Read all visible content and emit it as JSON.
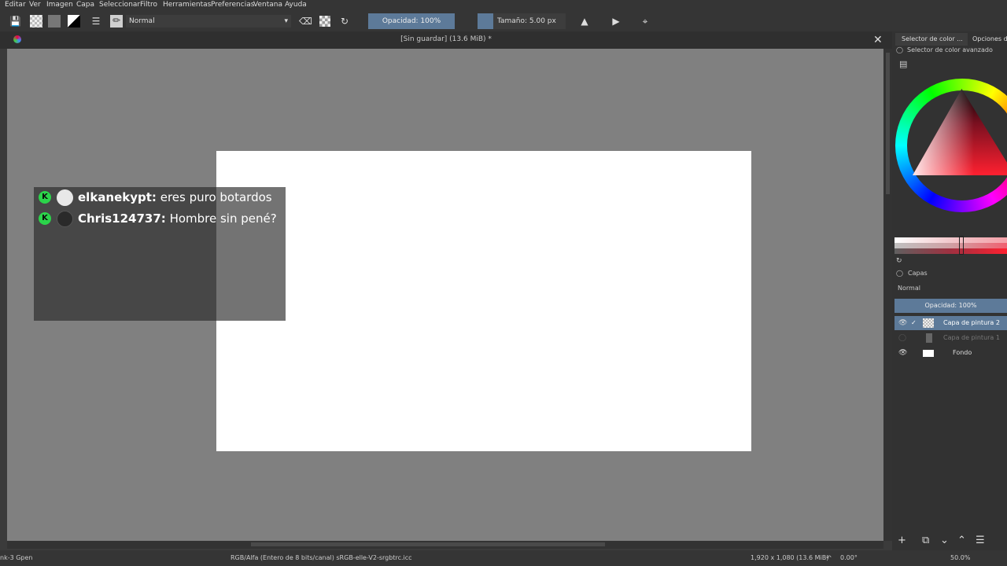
{
  "menu": [
    "Editar",
    "Ver",
    "Imagen",
    "Capa",
    "Seleccionar",
    "Filtro",
    "Herramientas",
    "Preferencias",
    "Ventana",
    "Ayuda"
  ],
  "toolbar": {
    "blend_mode": "Normal",
    "opacity": "Opacidad: 100%",
    "size": "Tamaño: 5.00 px"
  },
  "document": {
    "title": "[Sin guardar]  (13.6 MiB) *"
  },
  "chat": [
    {
      "user": "elkanekypt:",
      "message": "eres puro botardos",
      "badge": "K"
    },
    {
      "user": "Chris124737:",
      "message": "Hombre sin pené?",
      "badge": "K"
    }
  ],
  "docker": {
    "tabs": [
      "Selector de color ...",
      "Opciones de"
    ],
    "color_selector_title": "Selector de color avanzado",
    "layers_title": "Capas",
    "layers_blend": "Normal",
    "layers_opacity": "Opacidad:  100%",
    "layers": [
      {
        "name": "Capa de pintura 2",
        "visible": true,
        "active": true
      },
      {
        "name": "Capa de pintura 1",
        "visible": false,
        "active": false
      },
      {
        "name": "Fondo",
        "visible": true,
        "active": false
      }
    ]
  },
  "status": {
    "brush": "nk-3 Gpen",
    "color_model": "RGB/Alfa (Entero de 8 bits/canal)  sRGB-elle-V2-srgbtrc.icc",
    "image_size": "1,920 x 1,080 (13.6 MiB)",
    "rotation": "0.00°",
    "zoom": "50.0%"
  },
  "colors": {
    "accent": "#5d7a99",
    "canvas_bg": "#808080",
    "badge": "#2bd44a"
  }
}
